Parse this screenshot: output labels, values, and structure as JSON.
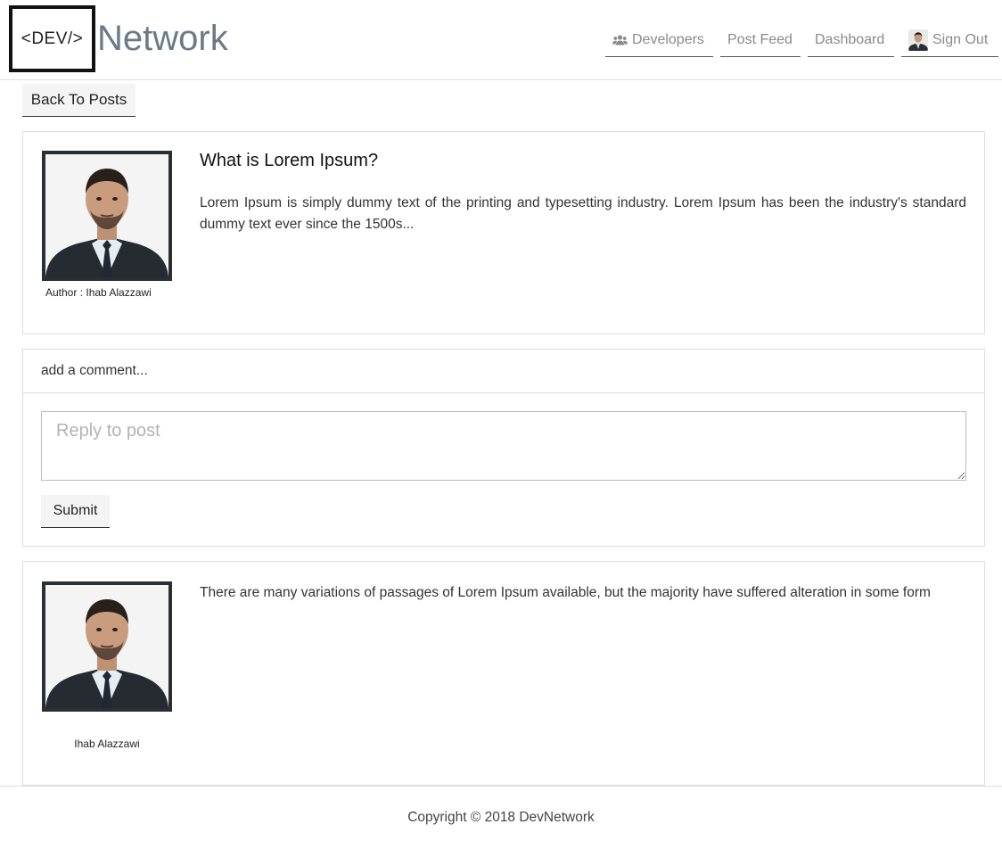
{
  "navbar": {
    "logo_text": "<DEV/>",
    "brand": "Network",
    "links": [
      {
        "label": "Developers",
        "icon": "users-icon"
      },
      {
        "label": "Post Feed"
      },
      {
        "label": "Dashboard"
      },
      {
        "label": "Sign Out",
        "icon": "avatar"
      }
    ]
  },
  "back_button": "Back To Posts",
  "post": {
    "title": "What is Lorem Ipsum?",
    "body": "Lorem Ipsum is simply dummy text of the printing and typesetting industry. Lorem Ipsum has been the industry's standard dummy text ever since the 1500s...",
    "author_label": "Author : Ihab Alazzawi"
  },
  "comment_form": {
    "header": "add a comment...",
    "placeholder": "Reply to post",
    "submit_label": "Submit"
  },
  "comments": [
    {
      "text": "There are many variations of passages of Lorem Ipsum available, but the majority have suffered alteration in some form",
      "author": "Ihab Alazzawi"
    }
  ],
  "footer": {
    "copyright": "Copyright © 2018 DevNetwork"
  },
  "colors": {
    "brand_text": "#6c7a86",
    "nav_text": "#8a8a8a",
    "button_bg": "#f4f4f4",
    "border": "#dedede"
  }
}
